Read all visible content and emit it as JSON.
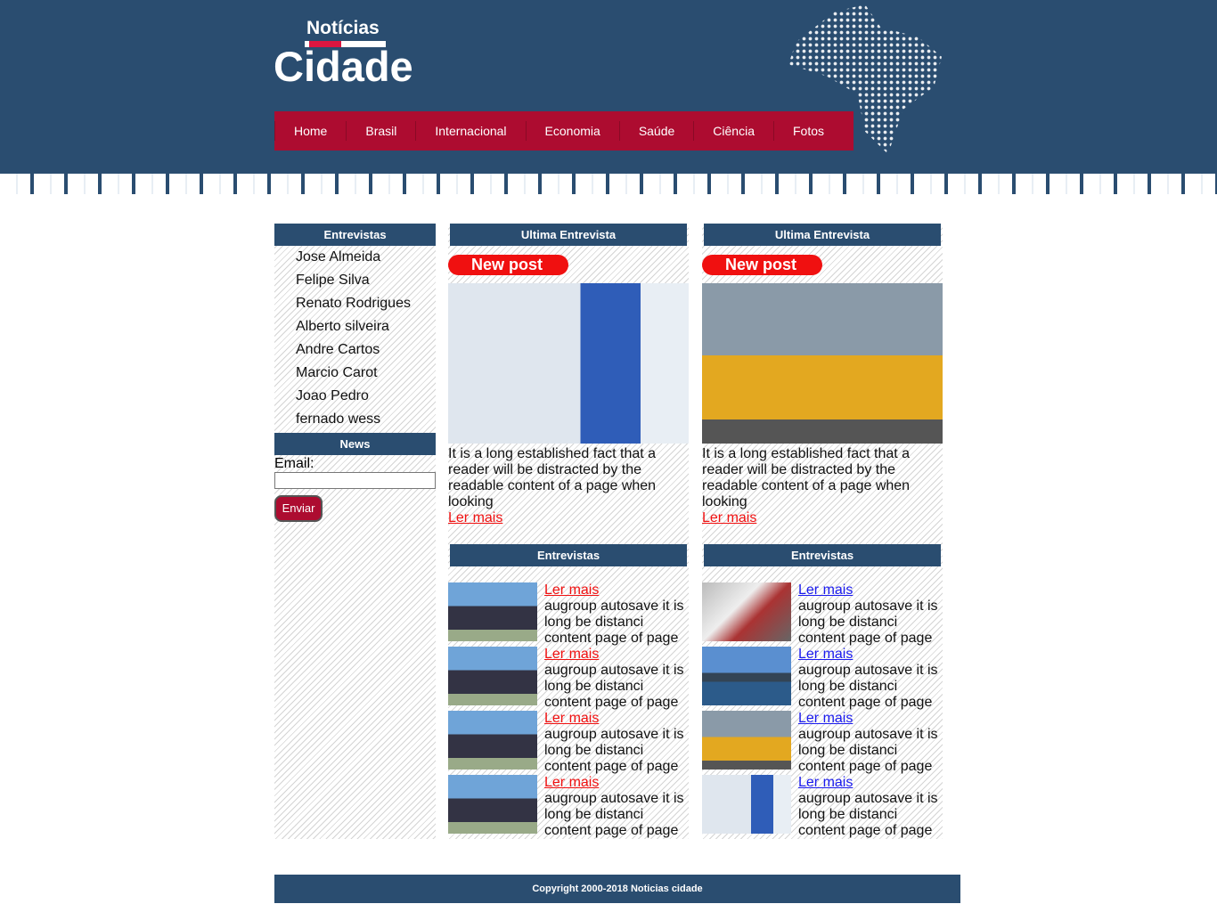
{
  "logo": {
    "top": "Notícias",
    "main": "Cidade"
  },
  "nav": [
    "Home",
    "Brasil",
    "Internacional",
    "Economia",
    "Saúde",
    "Ciência",
    "Fotos"
  ],
  "sidebar": {
    "title": "Entrevistas",
    "items": [
      "Jose Almeida",
      "Felipe Silva",
      "Renato Rodrigues",
      "Alberto silveira",
      "Andre Cartos",
      "Marcio Carot",
      "Joao Pedro",
      "fernado wess"
    ],
    "news": {
      "title": "News",
      "email_label": "Email:",
      "email_value": "",
      "button": "Enviar"
    }
  },
  "columns": [
    {
      "title": "Ultima Entrevista",
      "badge": "New post",
      "image": "doctor",
      "text": "It is a long established fact that a reader will be distracted by the readable content of a page when looking",
      "link": "Ler mais",
      "list_title": "Entrevistas",
      "link_color": "#f01010",
      "items": [
        {
          "image": "buildings",
          "link": "Ler mais",
          "text": "augroup autosave it is long be distanci content page of page"
        },
        {
          "image": "buildings",
          "link": "Ler mais",
          "text": "augroup autosave it is long be distanci content page of page"
        },
        {
          "image": "buildings",
          "link": "Ler mais",
          "text": "augroup autosave it is long be distanci content page of page"
        },
        {
          "image": "buildings",
          "link": "Ler mais",
          "text": "augroup autosave it is long be distanci content page of page"
        }
      ]
    },
    {
      "title": "Ultima Entrevista",
      "badge": "New post",
      "image": "taxis",
      "text": "It is a long established fact that a reader will be distracted by the readable content of a page when looking",
      "link": "Ler mais",
      "list_title": "Entrevistas",
      "link_color": "#1a1aee",
      "items": [
        {
          "image": "desk",
          "link": "Ler mais",
          "text": "augroup autosave it is long be distanci content page of page"
        },
        {
          "image": "skyline",
          "link": "Ler mais",
          "text": "augroup autosave it is long be distanci content page of page"
        },
        {
          "image": "taxis",
          "link": "Ler mais",
          "text": "augroup autosave it is long be distanci content page of page"
        },
        {
          "image": "doctor",
          "link": "Ler mais",
          "text": "augroup autosave it is long be distanci content page of page"
        }
      ]
    }
  ],
  "footer": "Copyright 2000-2018 Noticias cidade"
}
